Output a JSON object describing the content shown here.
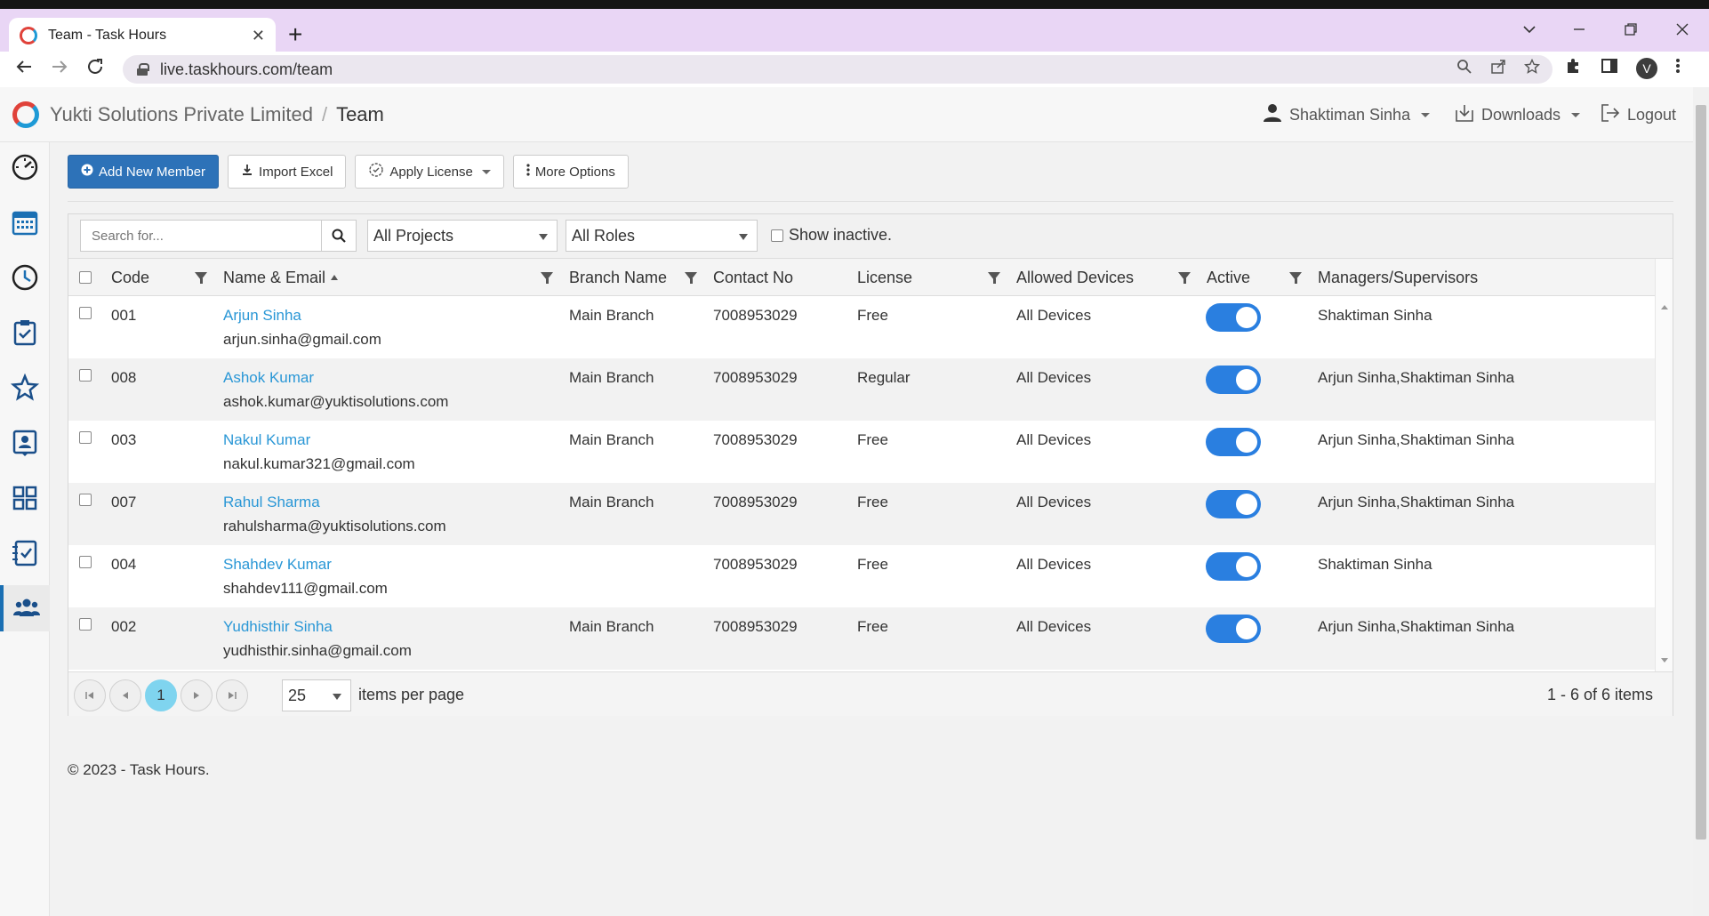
{
  "browser": {
    "tab_title": "Team - Task Hours",
    "tab_close": "✕",
    "new_tab": "+",
    "url": "live.taskhours.com/team",
    "avatar_initial": "V"
  },
  "header": {
    "company": "Yukti Solutions Private Limited",
    "separator": "/",
    "page_title": "Team",
    "user_name": "Shaktiman Sinha",
    "downloads_label": "Downloads",
    "logout_label": "Logout"
  },
  "sidebar": {
    "items": [
      {
        "icon": "dashboard-gauge-icon"
      },
      {
        "icon": "calendar-icon"
      },
      {
        "icon": "clock-icon"
      },
      {
        "icon": "clipboard-check-icon"
      },
      {
        "icon": "star-icon"
      },
      {
        "icon": "id-badge-icon"
      },
      {
        "icon": "grid-apps-icon"
      },
      {
        "icon": "task-list-icon"
      },
      {
        "icon": "team-users-icon",
        "active": true
      }
    ]
  },
  "toolbar": {
    "add_member_label": "Add New Member",
    "import_excel_label": "Import Excel",
    "apply_license_label": "Apply License",
    "more_options_label": "More Options"
  },
  "filters": {
    "search_placeholder": "Search for...",
    "projects_selected": "All Projects",
    "roles_selected": "All Roles",
    "show_inactive_label": "Show inactive."
  },
  "table": {
    "columns": {
      "code": "Code",
      "name_email": "Name & Email",
      "branch": "Branch Name",
      "contact": "Contact No",
      "license": "License",
      "devices": "Allowed Devices",
      "active": "Active",
      "managers": "Managers/Supervisors"
    },
    "rows": [
      {
        "code": "001",
        "name": "Arjun Sinha",
        "email": "arjun.sinha@gmail.com",
        "branch": "Main Branch",
        "contact": "7008953029",
        "license": "Free",
        "devices": "All Devices",
        "active": true,
        "managers": "Shaktiman Sinha"
      },
      {
        "code": "008",
        "name": "Ashok Kumar",
        "email": "ashok.kumar@yuktisolutions.com",
        "branch": "Main Branch",
        "contact": "7008953029",
        "license": "Regular",
        "devices": "All Devices",
        "active": true,
        "managers": "Arjun Sinha,Shaktiman Sinha"
      },
      {
        "code": "003",
        "name": "Nakul Kumar",
        "email": "nakul.kumar321@gmail.com",
        "branch": "Main Branch",
        "contact": "7008953029",
        "license": "Free",
        "devices": "All Devices",
        "active": true,
        "managers": "Arjun Sinha,Shaktiman Sinha"
      },
      {
        "code": "007",
        "name": "Rahul Sharma",
        "email": "rahulsharma@yuktisolutions.com",
        "branch": "Main Branch",
        "contact": "7008953029",
        "license": "Free",
        "devices": "All Devices",
        "active": true,
        "managers": "Arjun Sinha,Shaktiman Sinha"
      },
      {
        "code": "004",
        "name": "Shahdev Kumar",
        "email": "shahdev111@gmail.com",
        "branch": "",
        "contact": "7008953029",
        "license": "Free",
        "devices": "All Devices",
        "active": true,
        "managers": "Shaktiman Sinha"
      },
      {
        "code": "002",
        "name": "Yudhisthir Sinha",
        "email": "yudhisthir.sinha@gmail.com",
        "branch": "Main Branch",
        "contact": "7008953029",
        "license": "Free",
        "devices": "All Devices",
        "active": true,
        "managers": "Arjun Sinha,Shaktiman Sinha"
      }
    ]
  },
  "pager": {
    "current_page": "1",
    "page_size": "25",
    "items_per_page_label": "items per page",
    "summary": "1 - 6 of 6 items"
  },
  "footer": {
    "text": "© 2023 - Task Hours."
  },
  "colors": {
    "primary": "#2d72b8",
    "link": "#2a97d6",
    "toggle_on": "#2a7fe0",
    "current_page": "#7fd4ef"
  }
}
